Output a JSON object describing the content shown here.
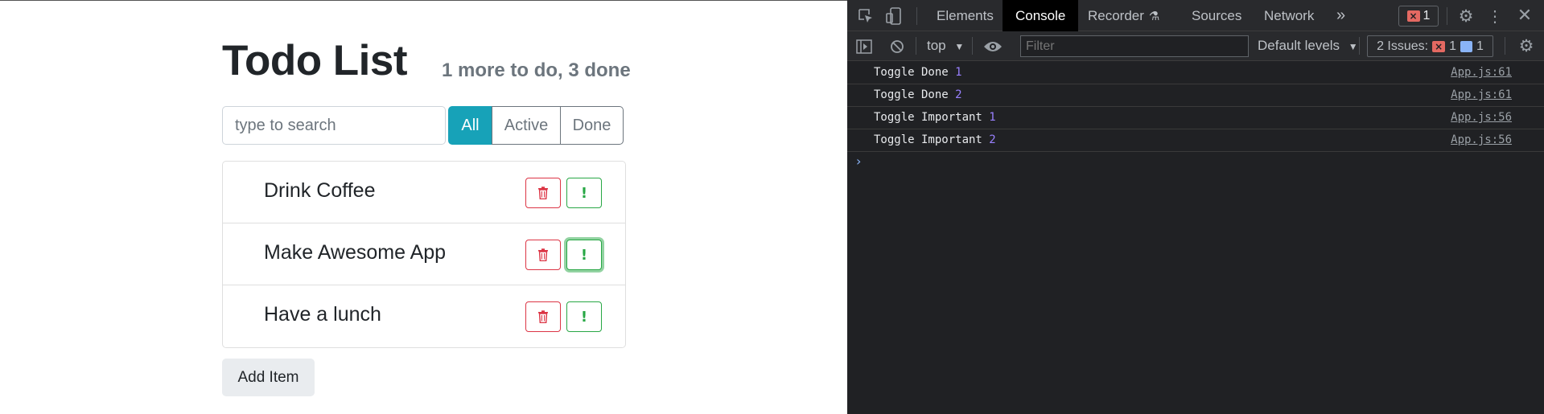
{
  "app": {
    "title": "Todo List",
    "counter": "1 more to do, 3 done",
    "search_placeholder": "type to search",
    "filters": {
      "all": "All",
      "active": "Active",
      "done": "Done",
      "selected": "All"
    },
    "items": [
      {
        "label": "Drink Coffee"
      },
      {
        "label": "Make Awesome App"
      },
      {
        "label": "Have a lunch"
      }
    ],
    "add_button": "Add Item",
    "colors": {
      "primary": "#17a2b8",
      "danger": "#dc3545",
      "success": "#28a745",
      "muted": "#6c757d"
    }
  },
  "devtools": {
    "tabs": {
      "elements": "Elements",
      "console": "Console",
      "recorder": "Recorder",
      "sources": "Sources",
      "network": "Network",
      "more": "»"
    },
    "active_tab": "Console",
    "error_count": "1",
    "toolbar": {
      "context": "top",
      "filter_placeholder": "Filter",
      "levels": "Default levels",
      "issues_label": "2 Issues:",
      "issues_errors": "1",
      "issues_messages": "1"
    },
    "logs": [
      {
        "text": "Toggle Done",
        "num": "1",
        "source": "App.js:61"
      },
      {
        "text": "Toggle Done",
        "num": "2",
        "source": "App.js:61"
      },
      {
        "text": "Toggle Important",
        "num": "1",
        "source": "App.js:56"
      },
      {
        "text": "Toggle Important",
        "num": "2",
        "source": "App.js:56"
      }
    ],
    "prompt": "›"
  }
}
